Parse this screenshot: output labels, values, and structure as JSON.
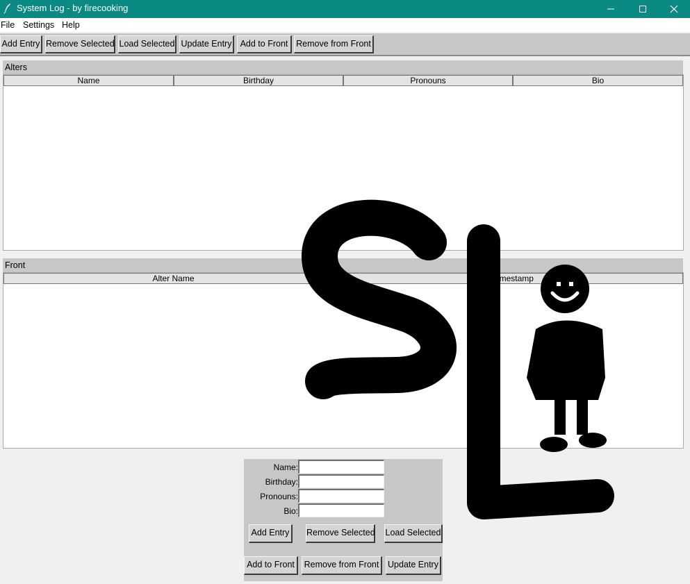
{
  "window": {
    "title": "System Log - by firecooking",
    "titlebar_color": "#0a8a83",
    "controls": [
      "minimize-icon",
      "maximize-icon",
      "close-icon"
    ]
  },
  "menu": [
    "File",
    "Settings",
    "Help"
  ],
  "toolbar": [
    "Add Entry",
    "Remove Selected",
    "Load Selected",
    "Update Entry",
    "Add to Front",
    "Remove from Front"
  ],
  "alters": {
    "title": "Alters",
    "columns": [
      "Name",
      "Birthday",
      "Pronouns",
      "Bio"
    ],
    "rows": []
  },
  "front": {
    "title": "Front",
    "columns": [
      "Alter Name",
      "Timestamp"
    ],
    "rows": []
  },
  "form": {
    "labels": [
      "Name:",
      "Birthday:",
      "Pronouns:",
      "Bio:"
    ],
    "values": [
      "",
      "",
      "",
      ""
    ],
    "buttons_row1": [
      "Add Entry",
      "Remove Selected",
      "Load Selected"
    ],
    "buttons_row2": [
      "Add to Front",
      "Remove from Front",
      "Update Entry"
    ]
  },
  "logo": {
    "text": "SL",
    "icon": "stick-figure-icon"
  }
}
